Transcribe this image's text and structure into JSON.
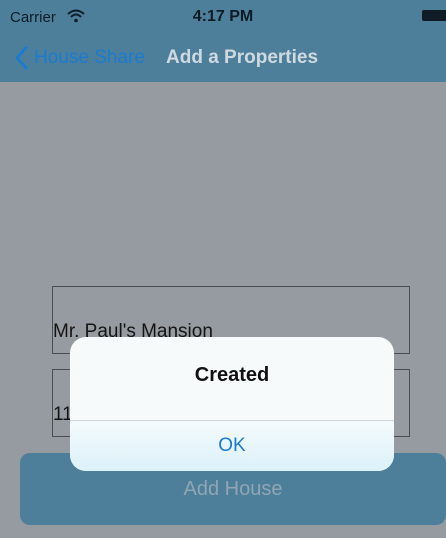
{
  "status_bar": {
    "carrier": "Carrier",
    "time": "4:17 PM",
    "icons": [
      "wifi-icon",
      "battery-icon"
    ]
  },
  "nav": {
    "back_label": "House Share",
    "title": "Add a Properties",
    "back_icon": "chevron-left-icon"
  },
  "form": {
    "name_value": "Mr. Paul's Mansion",
    "address_value": "11",
    "submit_label": "Add House"
  },
  "alert": {
    "title": "Created",
    "ok_label": "OK"
  },
  "colors": {
    "bar": "#4d7f9b",
    "accent": "#1a7bd0",
    "dimmed_background": "#959ba0"
  }
}
